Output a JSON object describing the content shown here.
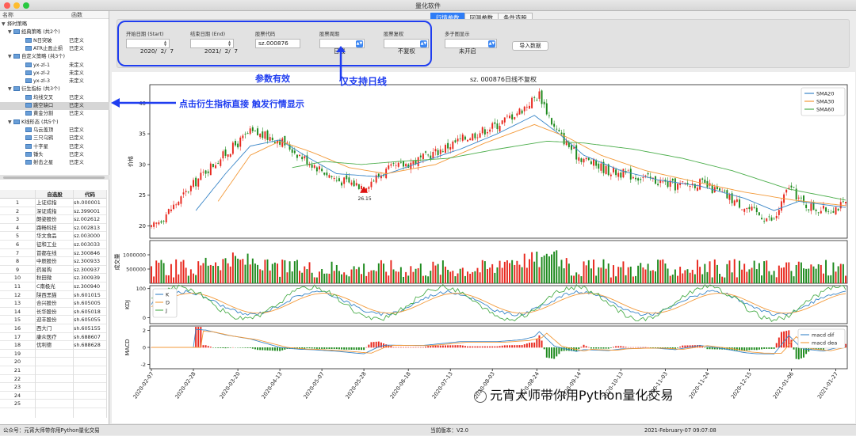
{
  "window": {
    "title": "量化软件"
  },
  "tree": {
    "headers": [
      "名称",
      "函数"
    ],
    "items": [
      {
        "label": "择时策略",
        "value": "",
        "level": 0
      },
      {
        "label": "经典策略 (共2个)",
        "value": "",
        "level": 1
      },
      {
        "label": "N日突破",
        "value": "已定义",
        "level": 2
      },
      {
        "label": "ATR止盈止损",
        "value": "已定义",
        "level": 2
      },
      {
        "label": "自定义策略 (共3个)",
        "value": "",
        "level": 1
      },
      {
        "label": "yx-zl-1",
        "value": "未定义",
        "level": 2
      },
      {
        "label": "yx-zl-2",
        "value": "未定义",
        "level": 2
      },
      {
        "label": "yx-zl-3",
        "value": "未定义",
        "level": 2
      },
      {
        "label": "衍生指标 (共3个)",
        "value": "",
        "level": 1
      },
      {
        "label": "均线交叉",
        "value": "已定义",
        "level": 2
      },
      {
        "label": "跳空缺口",
        "value": "已定义",
        "level": 2
      },
      {
        "label": "黄金分割",
        "value": "已定义",
        "level": 2
      },
      {
        "label": "K线形态 (共5个)",
        "value": "",
        "level": 1
      },
      {
        "label": "乌云盖顶",
        "value": "已定义",
        "level": 2
      },
      {
        "label": "三只乌鸦",
        "value": "已定义",
        "level": 2
      },
      {
        "label": "十字星",
        "value": "已定义",
        "level": 2
      },
      {
        "label": "锤头",
        "value": "已定义",
        "level": 2
      },
      {
        "label": "射击之星",
        "value": "已定义",
        "level": 2
      }
    ]
  },
  "stock_table": {
    "headers": [
      "自选股",
      "代码"
    ],
    "rows": [
      [
        "1",
        "上证综指",
        "sh.000001"
      ],
      [
        "2",
        "深证成指",
        "sz.399001"
      ],
      [
        "3",
        "朗姿股份",
        "sz.002612"
      ],
      [
        "4",
        "路畅科技",
        "sz.002813"
      ],
      [
        "5",
        "华文食品",
        "sz.003000"
      ],
      [
        "6",
        "征和工业",
        "sz.003033"
      ],
      [
        "7",
        "首都在线",
        "sz.300846"
      ],
      [
        "8",
        "中辰股份",
        "sz.300933"
      ],
      [
        "9",
        "药易购",
        "sz.300937"
      ],
      [
        "10",
        "秋田微",
        "sz.300939"
      ],
      [
        "11",
        "C南极光",
        "sz.300940"
      ],
      [
        "12",
        "陕西黑猫",
        "sh.601015"
      ],
      [
        "13",
        "合兴股份",
        "sh.605005"
      ],
      [
        "14",
        "长华股份",
        "sh.605018"
      ],
      [
        "15",
        "迎丰股份",
        "sh.605055"
      ],
      [
        "16",
        "西大门",
        "sh.605155"
      ],
      [
        "17",
        "康众医疗",
        "sh.688607"
      ],
      [
        "18",
        "优利德",
        "sh.688628"
      ],
      [
        "19",
        "",
        ""
      ],
      [
        "20",
        "",
        ""
      ],
      [
        "21",
        "",
        ""
      ],
      [
        "22",
        "",
        ""
      ],
      [
        "23",
        "",
        ""
      ],
      [
        "24",
        "",
        ""
      ],
      [
        "25",
        "",
        ""
      ]
    ]
  },
  "tabs": [
    "行情参数",
    "回测参数",
    "条件选股"
  ],
  "params": {
    "start_label": "开始日期 (Start)",
    "start_value": "2020/  2/  7",
    "end_label": "结束日期 (End)",
    "end_value": "2021/  2/  7",
    "code_label": "股票代码",
    "code_value": "sz.000876",
    "period_label": "股票周期",
    "period_value": "日线",
    "adjust_label": "股票复权",
    "adjust_value": "不复权",
    "subplot_label": "多子图显示",
    "subplot_value": "未开启",
    "import_button": "导入数据"
  },
  "annotations": {
    "params_valid": "参数有效",
    "daily_only": "仅支持日线",
    "click_hint": "点击衍生指标直接 触发行情显示"
  },
  "colors": {
    "up": "#e8281e",
    "down": "#1d8a1d",
    "sma20": "#3a86c8",
    "sma30": "#f39a3a",
    "sma60": "#4cae4c",
    "annotation": "#1f3df0"
  },
  "chart_data": {
    "type": "candlestick",
    "title": "sz. 000876日线不复权",
    "ylabel": "价格",
    "ylim": [
      18,
      43
    ],
    "yticks": [
      20,
      25,
      30,
      35,
      40
    ],
    "legend": [
      "SMA20",
      "SMA30",
      "SMA60"
    ],
    "legend_position": "top-right",
    "min_marker_label": "26.15",
    "x_ticks": [
      "2020-02-07",
      "2020-02-28",
      "2020-03-20",
      "2020-04-13",
      "2020-05-07",
      "2020-05-28",
      "2020-06-18",
      "2020-07-13",
      "2020-08-03",
      "2020-08-24",
      "2020-09-14",
      "2020-10-13",
      "2020-11-03",
      "2020-11-24",
      "2020-12-15",
      "2021-01-06",
      "2021-01-27"
    ],
    "price_anchors": [
      [
        0,
        19.5
      ],
      [
        12,
        24.5
      ],
      [
        22,
        29
      ],
      [
        40,
        35.2
      ],
      [
        52,
        34
      ],
      [
        60,
        31.5
      ],
      [
        75,
        27.5
      ],
      [
        86,
        26.5
      ],
      [
        95,
        29
      ],
      [
        110,
        31
      ],
      [
        125,
        34
      ],
      [
        140,
        36.5
      ],
      [
        150,
        39
      ],
      [
        157,
        41.5
      ],
      [
        163,
        36
      ],
      [
        172,
        31.5
      ],
      [
        185,
        29
      ],
      [
        200,
        27.8
      ],
      [
        212,
        26.5
      ],
      [
        222,
        27
      ],
      [
        232,
        25
      ],
      [
        245,
        22
      ],
      [
        252,
        20.8
      ],
      [
        258,
        26.5
      ],
      [
        264,
        23.5
      ],
      [
        272,
        22.5
      ],
      [
        281,
        23.5
      ]
    ],
    "sma20_anchors": [
      [
        18,
        22.5
      ],
      [
        30,
        28.5
      ],
      [
        40,
        33
      ],
      [
        52,
        34
      ],
      [
        64,
        31
      ],
      [
        75,
        28.5
      ],
      [
        92,
        28
      ],
      [
        110,
        30.5
      ],
      [
        125,
        32.5
      ],
      [
        140,
        35
      ],
      [
        155,
        38
      ],
      [
        165,
        35
      ],
      [
        175,
        31.5
      ],
      [
        190,
        29
      ],
      [
        205,
        27.5
      ],
      [
        222,
        26.5
      ],
      [
        240,
        24.5
      ],
      [
        252,
        22.5
      ],
      [
        262,
        24
      ],
      [
        281,
        23
      ]
    ],
    "sma30_anchors": [
      [
        27,
        24
      ],
      [
        40,
        31.5
      ],
      [
        52,
        33.8
      ],
      [
        65,
        32
      ],
      [
        80,
        29.5
      ],
      [
        95,
        28.5
      ],
      [
        115,
        30
      ],
      [
        135,
        33.5
      ],
      [
        155,
        36.5
      ],
      [
        168,
        34.5
      ],
      [
        182,
        31.5
      ],
      [
        200,
        29
      ],
      [
        220,
        27.2
      ],
      [
        240,
        25.5
      ],
      [
        260,
        24.2
      ],
      [
        281,
        23.3
      ]
    ],
    "sma60_anchors": [
      [
        57,
        29.5
      ],
      [
        70,
        30.5
      ],
      [
        85,
        30
      ],
      [
        100,
        30.5
      ],
      [
        120,
        31
      ],
      [
        140,
        32.5
      ],
      [
        160,
        33.8
      ],
      [
        175,
        33.5
      ],
      [
        195,
        32.5
      ],
      [
        215,
        31
      ],
      [
        235,
        29
      ],
      [
        258,
        26
      ],
      [
        281,
        24.2
      ]
    ],
    "volume": {
      "ylabel": "成交量",
      "yticks": [
        500000,
        1000000
      ],
      "ylim": [
        0,
        1500000
      ]
    },
    "kdj": {
      "ylabel": "KDJ",
      "yticks": [
        0,
        100
      ],
      "ylim": [
        -20,
        110
      ],
      "legend": [
        "K",
        "D",
        "J"
      ]
    },
    "macd": {
      "ylabel": "MACD",
      "yticks": [
        -2,
        0,
        2
      ],
      "ylim": [
        -2.5,
        2.5
      ],
      "legend": [
        "macd dif",
        "macd dea"
      ]
    }
  },
  "statusbar": {
    "left": "公众号：元宵大师带你用Python量化交易",
    "center": "当前版本：V2.0",
    "right": "2021-February-07 09:07:08"
  },
  "watermark": "元宵大师带你用Python量化交易"
}
